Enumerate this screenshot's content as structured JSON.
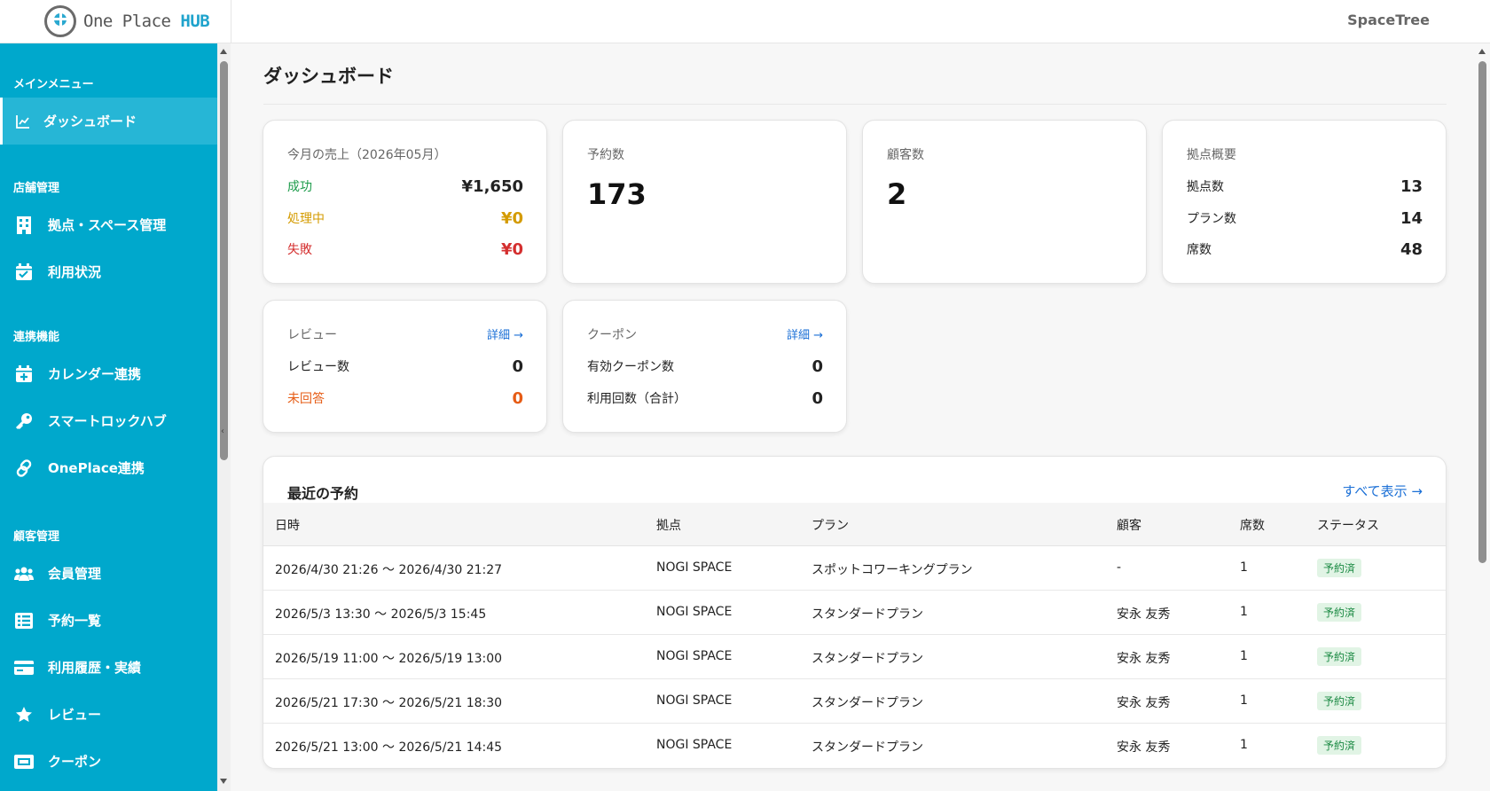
{
  "header": {
    "logo_text_1": "One Place ",
    "logo_text_2": "HUB",
    "org_name": "SpaceTree"
  },
  "sidebar": {
    "sections": [
      {
        "label": "メインメニュー"
      },
      {
        "label": "店舗管理"
      },
      {
        "label": "連携機能"
      },
      {
        "label": "顧客管理"
      }
    ],
    "items": [
      {
        "label": "ダッシュボード",
        "icon": "chart-line-icon",
        "active": true
      },
      {
        "label": "拠点・スペース管理",
        "icon": "building-icon"
      },
      {
        "label": "利用状況",
        "icon": "calendar-check-icon"
      },
      {
        "label": "カレンダー連携",
        "icon": "calendar-plus-icon"
      },
      {
        "label": "スマートロックハブ",
        "icon": "key-icon"
      },
      {
        "label": "OnePlace連携",
        "icon": "link-icon"
      },
      {
        "label": "会員管理",
        "icon": "users-icon"
      },
      {
        "label": "予約一覧",
        "icon": "list-icon"
      },
      {
        "label": "利用履歴・実績",
        "icon": "credit-card-icon"
      },
      {
        "label": "レビュー",
        "icon": "star-icon"
      },
      {
        "label": "クーポン",
        "icon": "ticket-icon"
      }
    ]
  },
  "page": {
    "title": "ダッシュボード"
  },
  "sales": {
    "label": "今月の売上（2026年05月）",
    "rows": [
      {
        "label": "成功",
        "value": "¥1,650"
      },
      {
        "label": "処理中",
        "value": "¥0"
      },
      {
        "label": "失敗",
        "value": "¥0"
      }
    ]
  },
  "reservations": {
    "label": "予約数",
    "value": "173"
  },
  "customers": {
    "label": "顧客数",
    "value": "2"
  },
  "locations": {
    "label": "拠点概要",
    "rows": [
      {
        "label": "拠点数",
        "value": "13"
      },
      {
        "label": "プラン数",
        "value": "14"
      },
      {
        "label": "席数",
        "value": "48"
      }
    ]
  },
  "reviews": {
    "label": "レビュー",
    "link": "詳細 →",
    "rows": [
      {
        "label": "レビュー数",
        "value": "0"
      },
      {
        "label": "未回答",
        "value": "0"
      }
    ]
  },
  "coupons": {
    "label": "クーポン",
    "link": "詳細 →",
    "rows": [
      {
        "label": "有効クーポン数",
        "value": "0"
      },
      {
        "label": "利用回数（合計）",
        "value": "0"
      }
    ]
  },
  "recent": {
    "title": "最近の予約",
    "link": "すべて表示 →",
    "columns": [
      "日時",
      "拠点",
      "プラン",
      "顧客",
      "席数",
      "ステータス"
    ],
    "rows": [
      {
        "datetime": "2026/4/30 21:26 〜 2026/4/30 21:27",
        "location": "NOGI SPACE",
        "plan": "スポットコワーキングプラン",
        "customer": "-",
        "seats": "1",
        "status": "予約済"
      },
      {
        "datetime": "2026/5/3 13:30 〜 2026/5/3 15:45",
        "location": "NOGI SPACE",
        "plan": "スタンダードプラン",
        "customer": "安永 友秀",
        "seats": "1",
        "status": "予約済"
      },
      {
        "datetime": "2026/5/19 11:00 〜 2026/5/19 13:00",
        "location": "NOGI SPACE",
        "plan": "スタンダードプラン",
        "customer": "安永 友秀",
        "seats": "1",
        "status": "予約済"
      },
      {
        "datetime": "2026/5/21 17:30 〜 2026/5/21 18:30",
        "location": "NOGI SPACE",
        "plan": "スタンダードプラン",
        "customer": "安永 友秀",
        "seats": "1",
        "status": "予約済"
      },
      {
        "datetime": "2026/5/21 13:00 〜 2026/5/21 14:45",
        "location": "NOGI SPACE",
        "plan": "スタンダードプラン",
        "customer": "安永 友秀",
        "seats": "1",
        "status": "予約済"
      }
    ]
  },
  "colors": {
    "sidebar": "#00a8cc",
    "success": "#1c9b4a",
    "pending": "#d49b00",
    "failed": "#d42f2f",
    "unanswered": "#e65c15",
    "link": "#1a6fd6"
  }
}
